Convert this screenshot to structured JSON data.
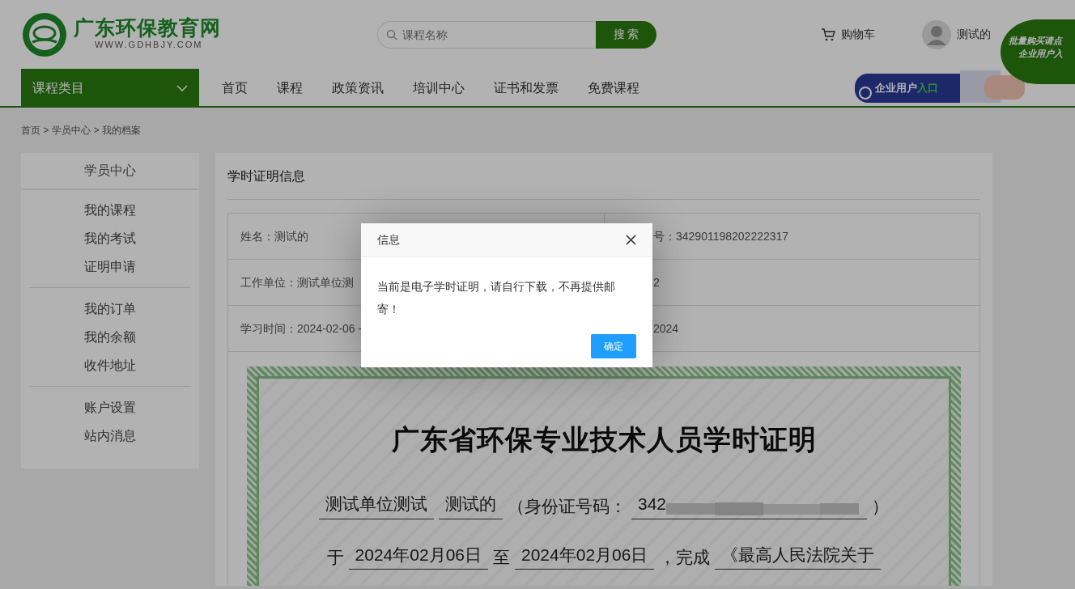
{
  "header": {
    "logo_title": "广东环保教育网",
    "logo_url": "WWW.GDHBJY.COM",
    "search": {
      "placeholder": "课程名称",
      "button": "搜 索"
    },
    "cart": "购物车",
    "user": "测试的"
  },
  "promo": {
    "bubble_lines": [
      "批量购买请点",
      "企业用户入"
    ],
    "banner_text": "企业用户",
    "banner_highlight": "入口"
  },
  "nav": {
    "category": "课程类目",
    "items": [
      "首页",
      "课程",
      "政策资讯",
      "培训中心",
      "证书和发票",
      "免费课程"
    ]
  },
  "breadcrumb": {
    "items": [
      "首页",
      "学员中心",
      "我的档案"
    ],
    "separator": ">"
  },
  "sidebar": {
    "title": "学员中心",
    "groups": [
      [
        "我的课程",
        "我的考试",
        "证明申请"
      ],
      [
        "我的订单",
        "我的余额",
        "收件地址"
      ],
      [
        "账户设置",
        "站内消息"
      ]
    ]
  },
  "main": {
    "title": "学时证明信息",
    "info_rows": [
      [
        "姓名：测试的",
        "号：342901198202222317"
      ],
      [
        "工作单位：测试单位测",
        "2"
      ],
      [
        "学习时间：2024-02-06 -",
        "2024"
      ]
    ]
  },
  "certificate": {
    "title": "广东省环保专业技术人员学时证明",
    "line1": [
      {
        "kind": "field",
        "text": "测试单位测试"
      },
      {
        "kind": "field",
        "text": "测试的"
      },
      {
        "kind": "plain",
        "text": "（身份证号码："
      },
      {
        "kind": "redacted",
        "text": "342"
      },
      {
        "kind": "plain",
        "text": "）"
      }
    ],
    "line2": [
      {
        "kind": "plain",
        "text": "于"
      },
      {
        "kind": "field",
        "text": "2024年02月06日"
      },
      {
        "kind": "plain",
        "text": "至"
      },
      {
        "kind": "field",
        "text": "2024年02月06日"
      },
      {
        "kind": "plain",
        "text": "，完成"
      },
      {
        "kind": "field",
        "text": "《最高人民法院关于"
      }
    ]
  },
  "dialog": {
    "title": "信息",
    "message": "当前是电子学时证明，请自行下载，不再提供邮寄！",
    "button": "确定"
  }
}
